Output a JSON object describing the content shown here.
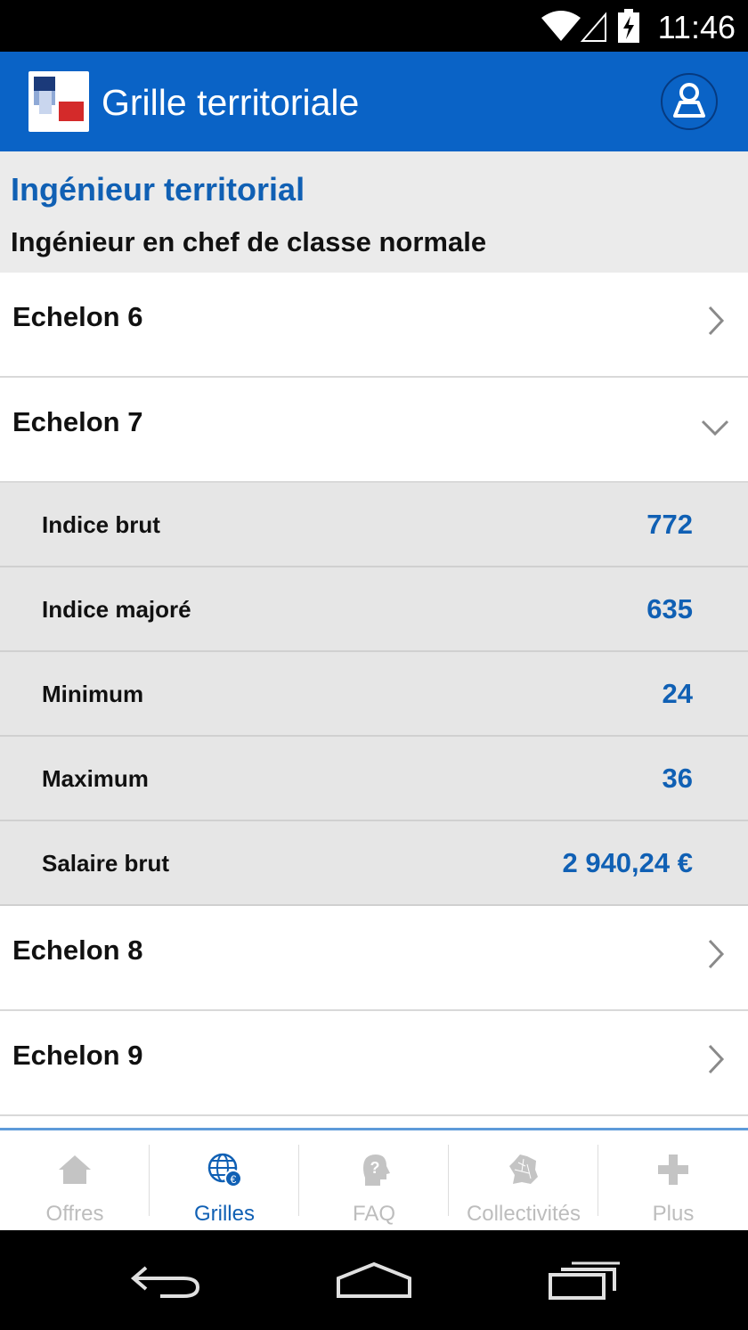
{
  "status_bar": {
    "time": "11:46"
  },
  "app_bar": {
    "title": "Grille territoriale"
  },
  "heading": {
    "title": "Ingénieur territorial",
    "subtitle": "Ingénieur en chef de classe normale"
  },
  "echelons": [
    {
      "label": "Echelon 6",
      "expanded": false
    },
    {
      "label": "Echelon 7",
      "expanded": true
    },
    {
      "label": "Echelon 8",
      "expanded": false
    },
    {
      "label": "Echelon 9",
      "expanded": false
    }
  ],
  "details": {
    "rows": [
      {
        "key": "Indice brut",
        "value": "772"
      },
      {
        "key": "Indice majoré",
        "value": "635"
      },
      {
        "key": "Minimum",
        "value": "24"
      },
      {
        "key": "Maximum",
        "value": "36"
      },
      {
        "key": "Salaire brut",
        "value": "2 940,24 €"
      }
    ]
  },
  "tabs": [
    {
      "label": "Offres",
      "icon": "home-icon",
      "active": false
    },
    {
      "label": "Grilles",
      "icon": "globe-euro-icon",
      "active": true
    },
    {
      "label": "FAQ",
      "icon": "question-head-icon",
      "active": false
    },
    {
      "label": "Collectivités",
      "icon": "france-map-icon",
      "active": false
    },
    {
      "label": "Plus",
      "icon": "plus-icon",
      "active": false
    }
  ],
  "colors": {
    "app_bar": "#0a63c6",
    "accent_text": "#1060b4",
    "heading_bg": "#ebebeb",
    "detail_bg": "#e6e6e6",
    "tab_inactive": "#bdbdbd"
  }
}
